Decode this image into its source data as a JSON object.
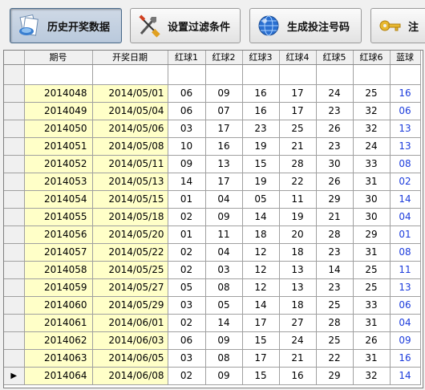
{
  "toolbar": {
    "buttons": [
      {
        "label": "历史开奖数据",
        "icon": "history-docs-icon"
      },
      {
        "label": "设置过滤条件",
        "icon": "tools-icon"
      },
      {
        "label": "生成投注号码",
        "icon": "globe-generate-icon"
      },
      {
        "label": "注",
        "icon": "key-icon"
      }
    ]
  },
  "grid": {
    "columns": [
      "期号",
      "开奖日期",
      "红球1",
      "红球2",
      "红球3",
      "红球4",
      "红球5",
      "红球6",
      "蓝球"
    ],
    "current_row_marker": "▶",
    "rows": [
      [
        "2014048",
        "2014/05/01",
        "06",
        "09",
        "16",
        "17",
        "24",
        "25",
        "16"
      ],
      [
        "2014049",
        "2014/05/04",
        "06",
        "07",
        "16",
        "17",
        "23",
        "32",
        "06"
      ],
      [
        "2014050",
        "2014/05/06",
        "03",
        "17",
        "23",
        "25",
        "26",
        "32",
        "13"
      ],
      [
        "2014051",
        "2014/05/08",
        "10",
        "16",
        "19",
        "21",
        "23",
        "24",
        "13"
      ],
      [
        "2014052",
        "2014/05/11",
        "09",
        "13",
        "15",
        "28",
        "30",
        "33",
        "08"
      ],
      [
        "2014053",
        "2014/05/13",
        "14",
        "17",
        "19",
        "22",
        "26",
        "31",
        "02"
      ],
      [
        "2014054",
        "2014/05/15",
        "01",
        "04",
        "05",
        "11",
        "29",
        "30",
        "14"
      ],
      [
        "2014055",
        "2014/05/18",
        "02",
        "09",
        "14",
        "19",
        "21",
        "30",
        "04"
      ],
      [
        "2014056",
        "2014/05/20",
        "01",
        "11",
        "18",
        "20",
        "28",
        "29",
        "01"
      ],
      [
        "2014057",
        "2014/05/22",
        "02",
        "04",
        "12",
        "18",
        "23",
        "31",
        "08"
      ],
      [
        "2014058",
        "2014/05/25",
        "02",
        "03",
        "12",
        "13",
        "14",
        "25",
        "11"
      ],
      [
        "2014059",
        "2014/05/27",
        "05",
        "08",
        "12",
        "13",
        "23",
        "25",
        "13"
      ],
      [
        "2014060",
        "2014/05/29",
        "03",
        "05",
        "14",
        "18",
        "25",
        "33",
        "06"
      ],
      [
        "2014061",
        "2014/06/01",
        "02",
        "14",
        "17",
        "27",
        "28",
        "31",
        "04"
      ],
      [
        "2014062",
        "2014/06/03",
        "06",
        "09",
        "15",
        "24",
        "25",
        "26",
        "09"
      ],
      [
        "2014063",
        "2014/06/05",
        "03",
        "08",
        "17",
        "21",
        "22",
        "31",
        "16"
      ],
      [
        "2014064",
        "2014/06/08",
        "02",
        "09",
        "15",
        "16",
        "29",
        "32",
        "14"
      ]
    ]
  },
  "colors": {
    "id_date_cell_bg": "#ffffc8",
    "blue_ball_text": "#1c3cdc"
  }
}
